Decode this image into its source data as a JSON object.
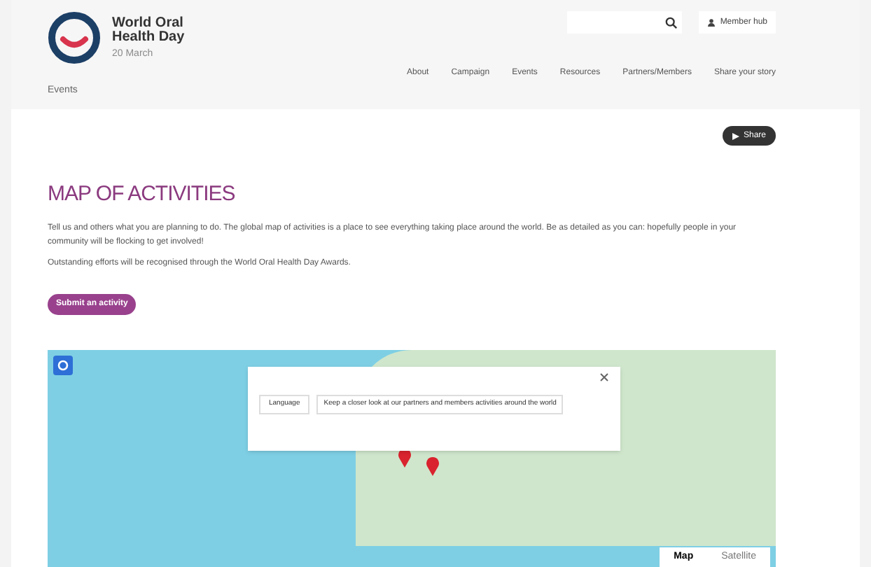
{
  "header": {
    "logo": {
      "title_line_1": "World Oral",
      "title_line_2": "Health Day",
      "subtitle": "20 March"
    },
    "member_button": "Member hub",
    "nav": [
      "About",
      "Campaign",
      "Events",
      "Resources",
      "Partners/Members",
      "Share your story"
    ],
    "breadcrumb": "Events"
  },
  "share_button": "Share",
  "heading": "MAP OF ACTIVITIES",
  "paragraphs": [
    "Tell us and others what you are planning to do. The global map of activities is a place to see everything taking place around the world. Be as detailed as you can: hopefully people in your community will be flocking to get involved!",
    "Outstanding efforts will be recognised through the World Oral Health Day Awards."
  ],
  "submit_button": "Submit an activity",
  "map": {
    "popup": {
      "button": "Language",
      "text": "Keep a closer look at our partners and members activities around the world"
    },
    "types": [
      {
        "label": "Map",
        "selected": true
      },
      {
        "label": "Satellite",
        "selected": false
      }
    ]
  }
}
